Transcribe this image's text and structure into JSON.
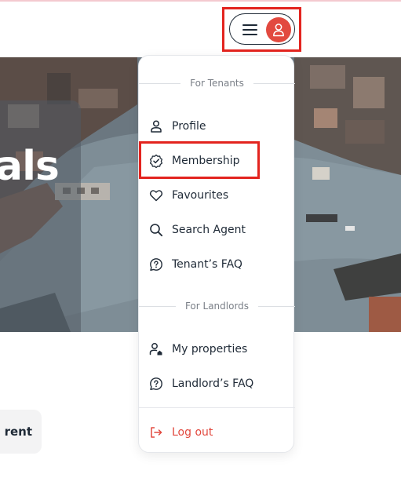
{
  "hero": {
    "heading_fragment": "als"
  },
  "cta": {
    "rent_label": "o rent"
  },
  "header": {
    "menu_icon": "hamburger-icon",
    "avatar_icon": "user-icon",
    "accent_color": "#e2493f"
  },
  "menu": {
    "tenants_heading": "For Tenants",
    "tenant_items": [
      {
        "label": "Profile",
        "icon": "user-icon"
      },
      {
        "label": "Membership",
        "icon": "badge-check-icon"
      },
      {
        "label": "Favourites",
        "icon": "heart-icon"
      },
      {
        "label": "Search Agent",
        "icon": "search-icon"
      },
      {
        "label": "Tenant’s FAQ",
        "icon": "question-icon"
      }
    ],
    "landlords_heading": "For Landlords",
    "landlord_items": [
      {
        "label": "My properties",
        "icon": "user-home-icon"
      },
      {
        "label": "Landlord’s FAQ",
        "icon": "question-icon"
      }
    ],
    "logout_label": "Log out",
    "logout_icon": "logout-icon",
    "logout_color": "#e2493f"
  }
}
